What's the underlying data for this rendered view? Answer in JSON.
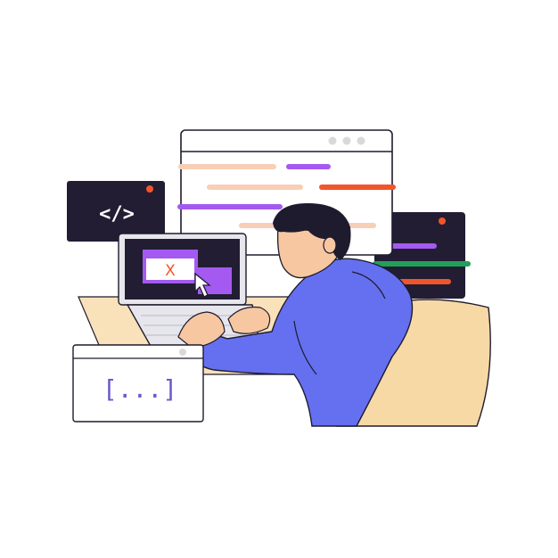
{
  "illustration": {
    "code_badge_text": "</>",
    "error_mark_text": "X",
    "snippet_text": "[...]",
    "icons": [
      "code-window",
      "browser-window",
      "laptop",
      "mouse-cursor",
      "developer-person",
      "office-chair",
      "snippet-window"
    ]
  },
  "colors": {
    "outline": "#1f1b2e",
    "dark_panel": "#221d33",
    "purple": "#a45af0",
    "peach": "#f8cfb6",
    "orange": "#f0562a",
    "green": "#22a05a",
    "hoodie": "#6470ef",
    "skin": "#f6c7a1",
    "hair": "#1f1b2e",
    "chair": "#f7d9a6",
    "desk": "#f9e1b9",
    "window_dot": "#d9d9d9"
  }
}
